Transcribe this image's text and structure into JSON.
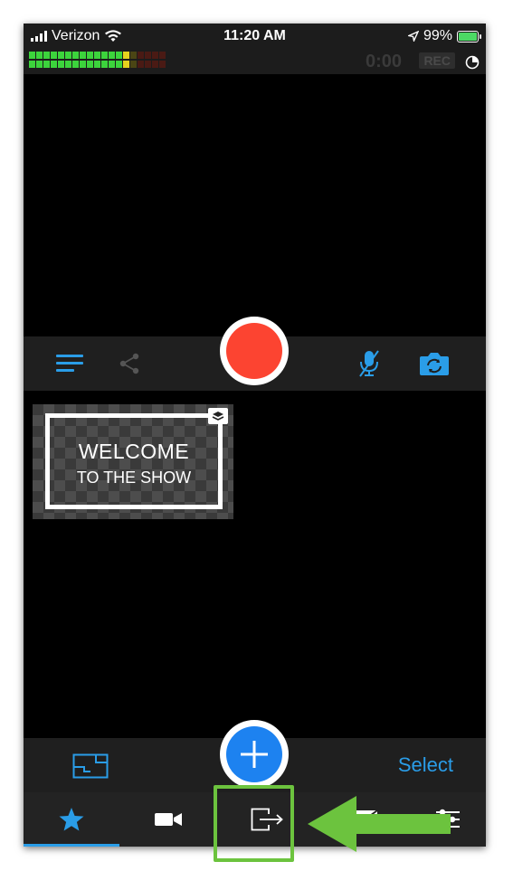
{
  "status_bar": {
    "carrier": "Verizon",
    "time": "11:20 AM",
    "battery_percent": "99%",
    "battery_level": 0.99,
    "signal_bars": 4
  },
  "meter": {
    "level_fraction": 0.74,
    "timer": "0:00",
    "rec_label": "REC"
  },
  "overlay_thumbnail": {
    "title": "WELCOME",
    "subtitle": "TO THE SHOW"
  },
  "toolbar": {
    "select_label": "Select"
  },
  "icons": {
    "menu": "menu-lines-icon",
    "share": "share-icon",
    "mic": "mic-off-icon",
    "camera": "camera-switch-icon",
    "layout": "layout-icon",
    "plus": "plus-icon",
    "star": "star-icon",
    "video": "video-camera-icon",
    "output": "output-exit-icon",
    "mail": "mail-icon",
    "sliders": "sliders-icon"
  },
  "colors": {
    "accent": "#2a9de8",
    "record": "#fc4431",
    "add": "#1d82f0",
    "highlight": "#6cc33e"
  }
}
